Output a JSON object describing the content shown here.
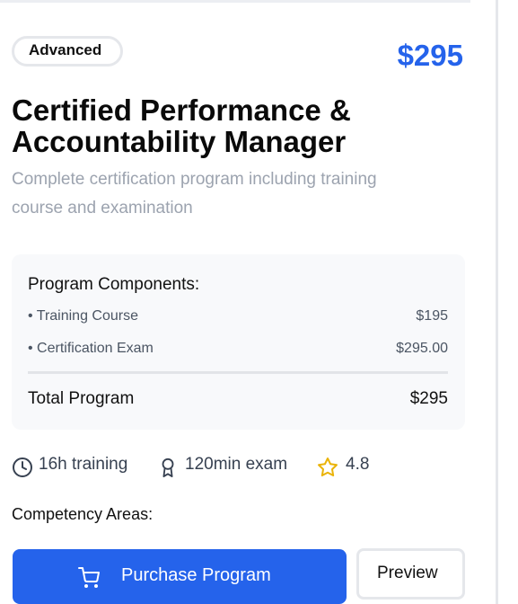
{
  "card": {
    "level_badge": "Advanced",
    "price": "$295",
    "title_line1": "Certified Performance &",
    "title_line2": "Accountability Manager",
    "subtitle_line1": "Complete certification program including training",
    "subtitle_line2": "course and examination"
  },
  "components": {
    "header": "Program Components:",
    "items": [
      {
        "name": "• Training Course",
        "value": "$195"
      },
      {
        "name": "• Certification Exam",
        "value": "$295.00"
      }
    ],
    "total_label": "Total Program",
    "total_value": "$295"
  },
  "stats": {
    "training": "16h training",
    "exam": "120min exam",
    "rating": "4.8",
    "icons": [
      "clock-icon",
      "award-icon",
      "star-icon"
    ]
  },
  "competency_label": "Competency Areas:",
  "actions": {
    "purchase_label": "Purchase Program",
    "preview_label": "Preview"
  },
  "colors": {
    "accent": "#2563eb",
    "star": "#eab308",
    "muted": "#9ca3af"
  }
}
